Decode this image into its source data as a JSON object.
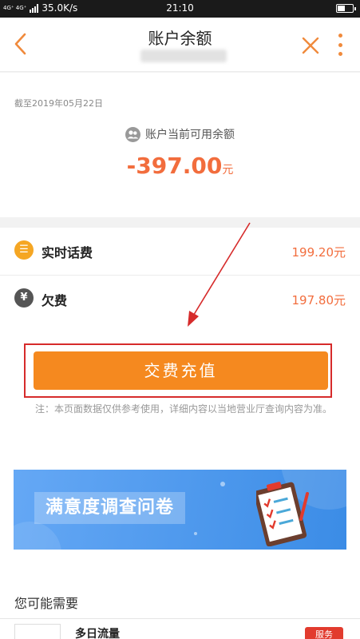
{
  "status_bar": {
    "network": "4G⁺ 4G⁺",
    "speed": "35.0K/s",
    "time": "21:10"
  },
  "header": {
    "title": "账户余额"
  },
  "balance": {
    "as_of": "截至2019年05月22日",
    "label": "账户当前可用余额",
    "value": "-397.00",
    "unit": "元"
  },
  "items": [
    {
      "icon": "list-icon",
      "icon_glyph": "☰",
      "icon_color": "#f5a623",
      "label": "实时话费",
      "value": "199.20元"
    },
    {
      "icon": "yen-icon",
      "icon_glyph": "¥",
      "icon_color": "#555555",
      "label": "欠费",
      "value": "197.80元"
    }
  ],
  "recharge": {
    "button_label": "交费充值",
    "note": "注：本页面数据仅供参考使用，详细内容以当地营业厅查询内容为准。"
  },
  "banner": {
    "text": "满意度调查问卷"
  },
  "recommend": {
    "title": "您可能需要",
    "card_name": "多日流量",
    "card_tag": "服务"
  },
  "colors": {
    "accent": "#f26d3d",
    "button": "#f5891f",
    "annotation": "#d62b2b"
  }
}
